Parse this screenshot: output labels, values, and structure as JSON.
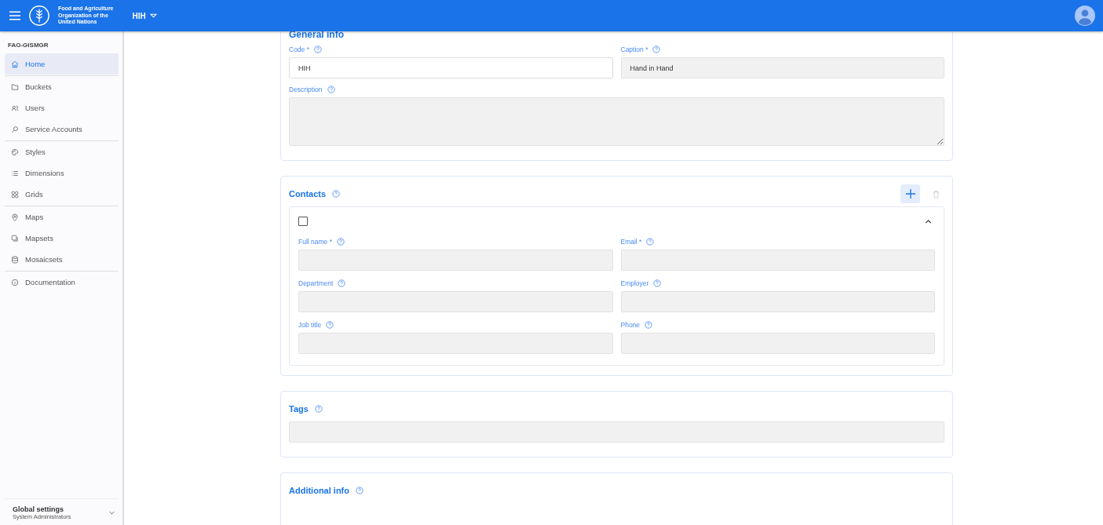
{
  "header": {
    "org_lines": [
      "Food and Agriculture",
      "Organization of the",
      "United Nations"
    ],
    "project": "HIH"
  },
  "sidebar": {
    "title": "FAO-GISMGR",
    "groups": [
      [
        {
          "label": "Home",
          "selected": true
        }
      ],
      [
        {
          "label": "Buckets",
          "selected": false
        },
        {
          "label": "Users",
          "selected": false
        },
        {
          "label": "Service Accounts",
          "selected": false
        }
      ],
      [
        {
          "label": "Styles",
          "selected": false
        },
        {
          "label": "Dimensions",
          "selected": false
        },
        {
          "label": "Grids",
          "selected": false
        }
      ],
      [
        {
          "label": "Maps",
          "selected": false
        },
        {
          "label": "Mapsets",
          "selected": false
        },
        {
          "label": "Mosaicsets",
          "selected": false
        }
      ],
      [
        {
          "label": "Documentation",
          "selected": false
        }
      ]
    ],
    "footer": {
      "title": "Global settings",
      "subtitle": "System Administrators",
      "expanded": false
    }
  },
  "general_info": {
    "title": "General info",
    "fields": [
      {
        "label": "Code *",
        "value": "HIH",
        "disabled": false
      },
      {
        "label": "Caption *",
        "value": "Hand in Hand",
        "disabled": true
      }
    ],
    "description": {
      "label": "Description"
    }
  },
  "contacts": {
    "title": "Contacts",
    "contact": {
      "checked": false,
      "expanded": true,
      "fields": [
        {
          "label": "Full name *"
        },
        {
          "label": "Email *"
        },
        {
          "label": "Department"
        },
        {
          "label": "Employer"
        },
        {
          "label": "Job title"
        },
        {
          "label": "Phone"
        }
      ]
    }
  },
  "tags": {
    "title": "Tags"
  },
  "additional_info": {
    "title": "Additional info"
  }
}
